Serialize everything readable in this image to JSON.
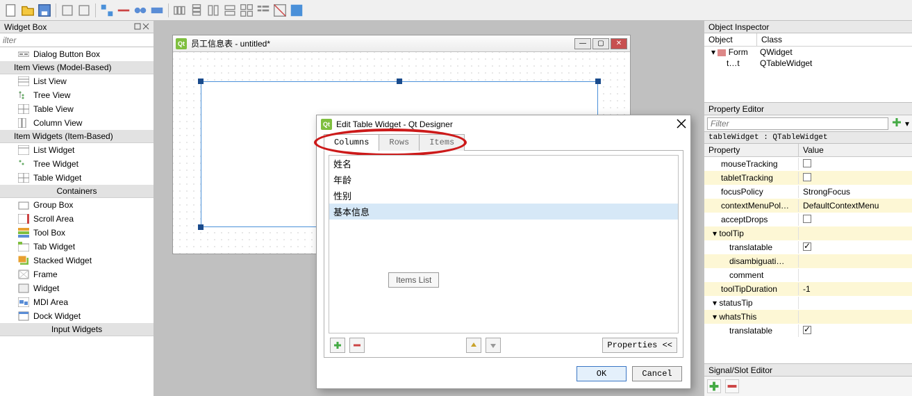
{
  "toolbar": {},
  "widgetBox": {
    "title": "Widget Box",
    "filter_placeholder": "ilter",
    "cat1": "Dialog Button Box",
    "cat2": "Item Views (Model-Based)",
    "itemViews": [
      "List View",
      "Tree View",
      "Table View",
      "Column View"
    ],
    "cat3": "Item Widgets (Item-Based)",
    "itemWidgets": [
      "List Widget",
      "Tree Widget",
      "Table Widget"
    ],
    "cat4": "Containers",
    "containers": [
      "Group Box",
      "Scroll Area",
      "Tool Box",
      "Tab Widget",
      "Stacked Widget",
      "Frame",
      "Widget",
      "MDI Area",
      "Dock Widget"
    ],
    "cat5": "Input Widgets"
  },
  "form": {
    "title": "员工信息表 - untitled*"
  },
  "dialog": {
    "title": "Edit Table Widget - Qt Designer",
    "tabs": [
      "Columns",
      "Rows",
      "Items"
    ],
    "activeTab": 0,
    "items": [
      "姓名",
      "年龄",
      "性别",
      "基本信息"
    ],
    "selected": 3,
    "balloon": "Items List",
    "properties_btn": "Properties <<",
    "ok": "OK",
    "cancel": "Cancel"
  },
  "objectInspector": {
    "title": "Object Inspector",
    "headers": [
      "Object",
      "Class"
    ],
    "rows": [
      {
        "obj": " Form",
        "cls": "QWidget",
        "top": true
      },
      {
        "obj": "t…t",
        "cls": "QTableWidget",
        "top": false
      }
    ]
  },
  "propertyEditor": {
    "title": "Property Editor",
    "filter_placeholder": "Filter",
    "object_label": "tableWidget : QTableWidget",
    "headers": [
      "Property",
      "Value"
    ],
    "rows": [
      {
        "name": "mouseTracking",
        "type": "check",
        "checked": false,
        "yellow": false
      },
      {
        "name": "tabletTracking",
        "type": "check",
        "checked": false,
        "yellow": true
      },
      {
        "name": "focusPolicy",
        "type": "text",
        "value": "StrongFocus",
        "yellow": false
      },
      {
        "name": "contextMenuPol…",
        "type": "text",
        "value": "DefaultContextMenu",
        "yellow": true
      },
      {
        "name": "acceptDrops",
        "type": "check",
        "checked": false,
        "yellow": false
      },
      {
        "name": "toolTip",
        "type": "expander",
        "value": "",
        "yellow": true,
        "exp": true
      },
      {
        "name": "translatable",
        "type": "check",
        "checked": true,
        "yellow": false,
        "sub": true
      },
      {
        "name": "disambiguati…",
        "type": "text",
        "value": "",
        "yellow": true,
        "sub": true
      },
      {
        "name": "comment",
        "type": "text",
        "value": "",
        "yellow": false,
        "sub": true
      },
      {
        "name": "toolTipDuration",
        "type": "text",
        "value": "-1",
        "yellow": true
      },
      {
        "name": "statusTip",
        "type": "expander",
        "value": "",
        "yellow": false,
        "exp": true
      },
      {
        "name": "whatsThis",
        "type": "expander",
        "value": "",
        "yellow": true,
        "exp": true
      },
      {
        "name": "translatable",
        "type": "check",
        "checked": true,
        "yellow": false,
        "sub": true
      }
    ]
  },
  "slotEditor": {
    "title": "Signal/Slot Editor"
  }
}
